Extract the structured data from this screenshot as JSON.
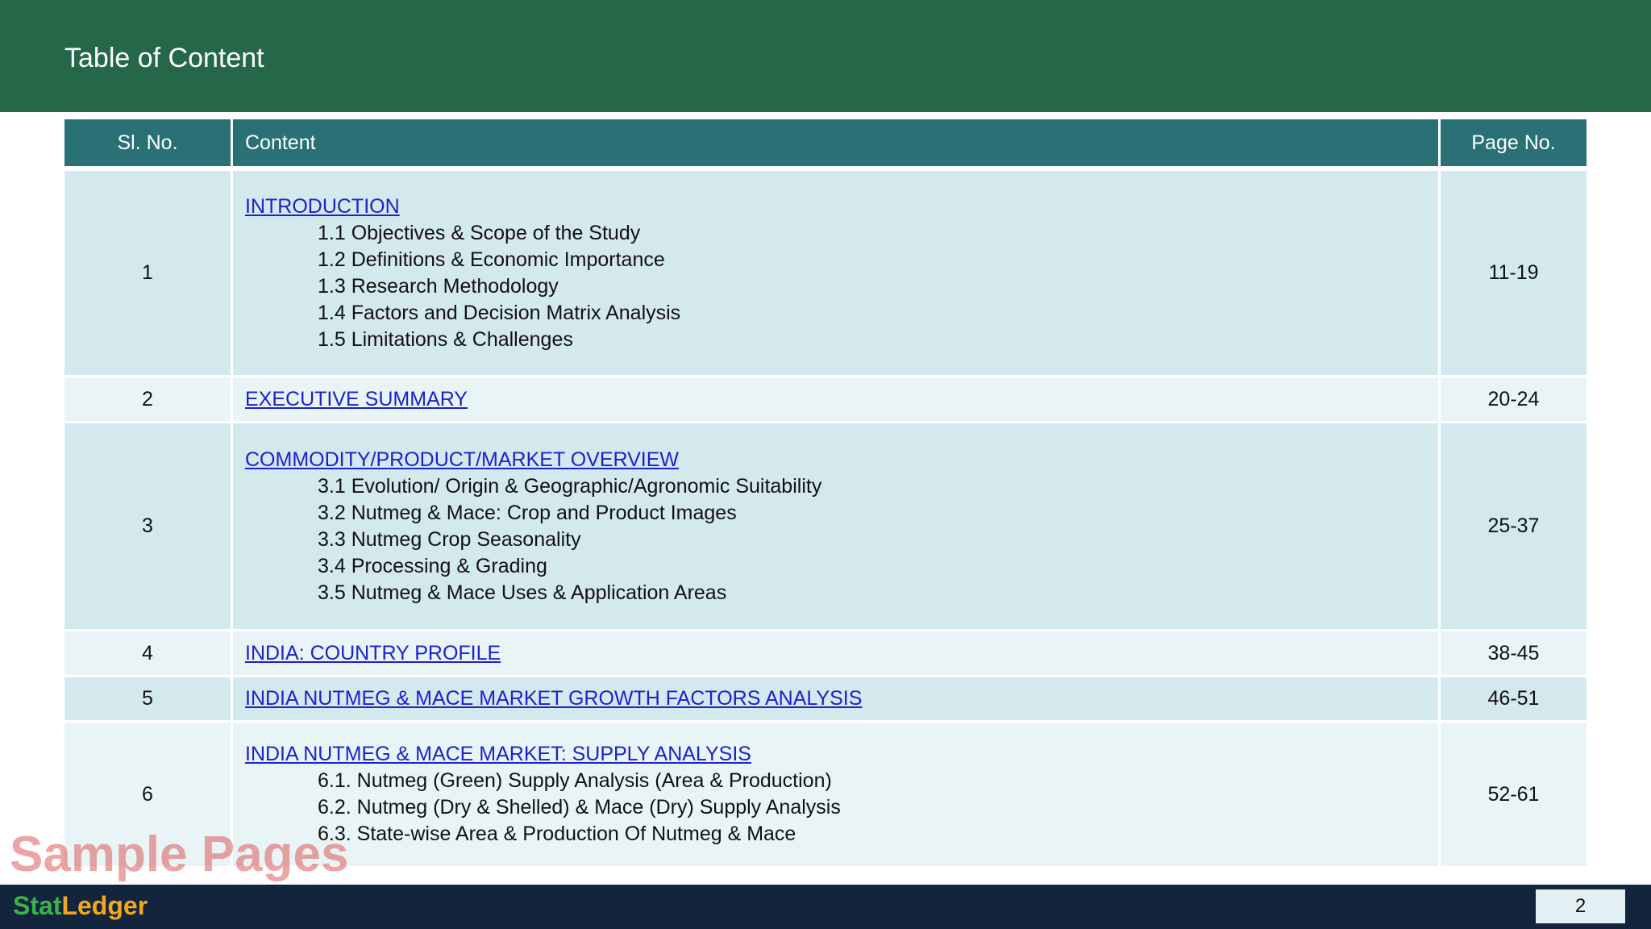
{
  "header": {
    "title": "Table of Content"
  },
  "table": {
    "columns": [
      "Sl. No.",
      "Content",
      "Page No."
    ],
    "rows": [
      {
        "num": "1",
        "title": "INTRODUCTION",
        "items": [
          "1.1 Objectives & Scope of the Study",
          "1.2 Definitions & Economic Importance",
          "1.3 Research Methodology",
          "1.4 Factors and Decision Matrix Analysis",
          "1.5 Limitations & Challenges"
        ],
        "pages": "11-19"
      },
      {
        "num": "2",
        "title": "EXECUTIVE SUMMARY",
        "items": [],
        "pages": "20-24"
      },
      {
        "num": "3",
        "title": "COMMODITY/PRODUCT/MARKET OVERVIEW",
        "items": [
          "3.1 Evolution/ Origin & Geographic/Agronomic Suitability",
          "3.2 Nutmeg & Mace: Crop and Product Images",
          "3.3 Nutmeg Crop Seasonality",
          "3.4 Processing & Grading",
          "3.5 Nutmeg & Mace Uses & Application Areas"
        ],
        "pages": "25-37"
      },
      {
        "num": "4",
        "title": "INDIA: COUNTRY PROFILE",
        "items": [],
        "pages": "38-45"
      },
      {
        "num": "5",
        "title": "INDIA NUTMEG & MACE MARKET GROWTH FACTORS ANALYSIS",
        "items": [],
        "pages": "46-51"
      },
      {
        "num": "6",
        "title": "INDIA NUTMEG & MACE MARKET: SUPPLY ANALYSIS",
        "items": [
          "6.1. Nutmeg (Green) Supply Analysis (Area & Production)",
          "6.2. Nutmeg (Dry & Shelled) & Mace (Dry) Supply Analysis",
          "6.3. State-wise Area & Production Of Nutmeg & Mace"
        ],
        "pages": "52-61"
      }
    ]
  },
  "watermark": "Sample Pages",
  "footer": {
    "logo_part1": "Stat",
    "logo_part2": "Ledger",
    "page_number": "2"
  },
  "colors": {
    "header_bg": "#256849",
    "table_header_bg": "#2a7176",
    "row_dark": "#d3e9ed",
    "row_light": "#e9f4f6",
    "link": "#1a22cc",
    "footer_bg": "#13243d",
    "logo_green": "#3bb24a",
    "logo_orange": "#f2a81d",
    "watermark": "#dc5a5a"
  }
}
